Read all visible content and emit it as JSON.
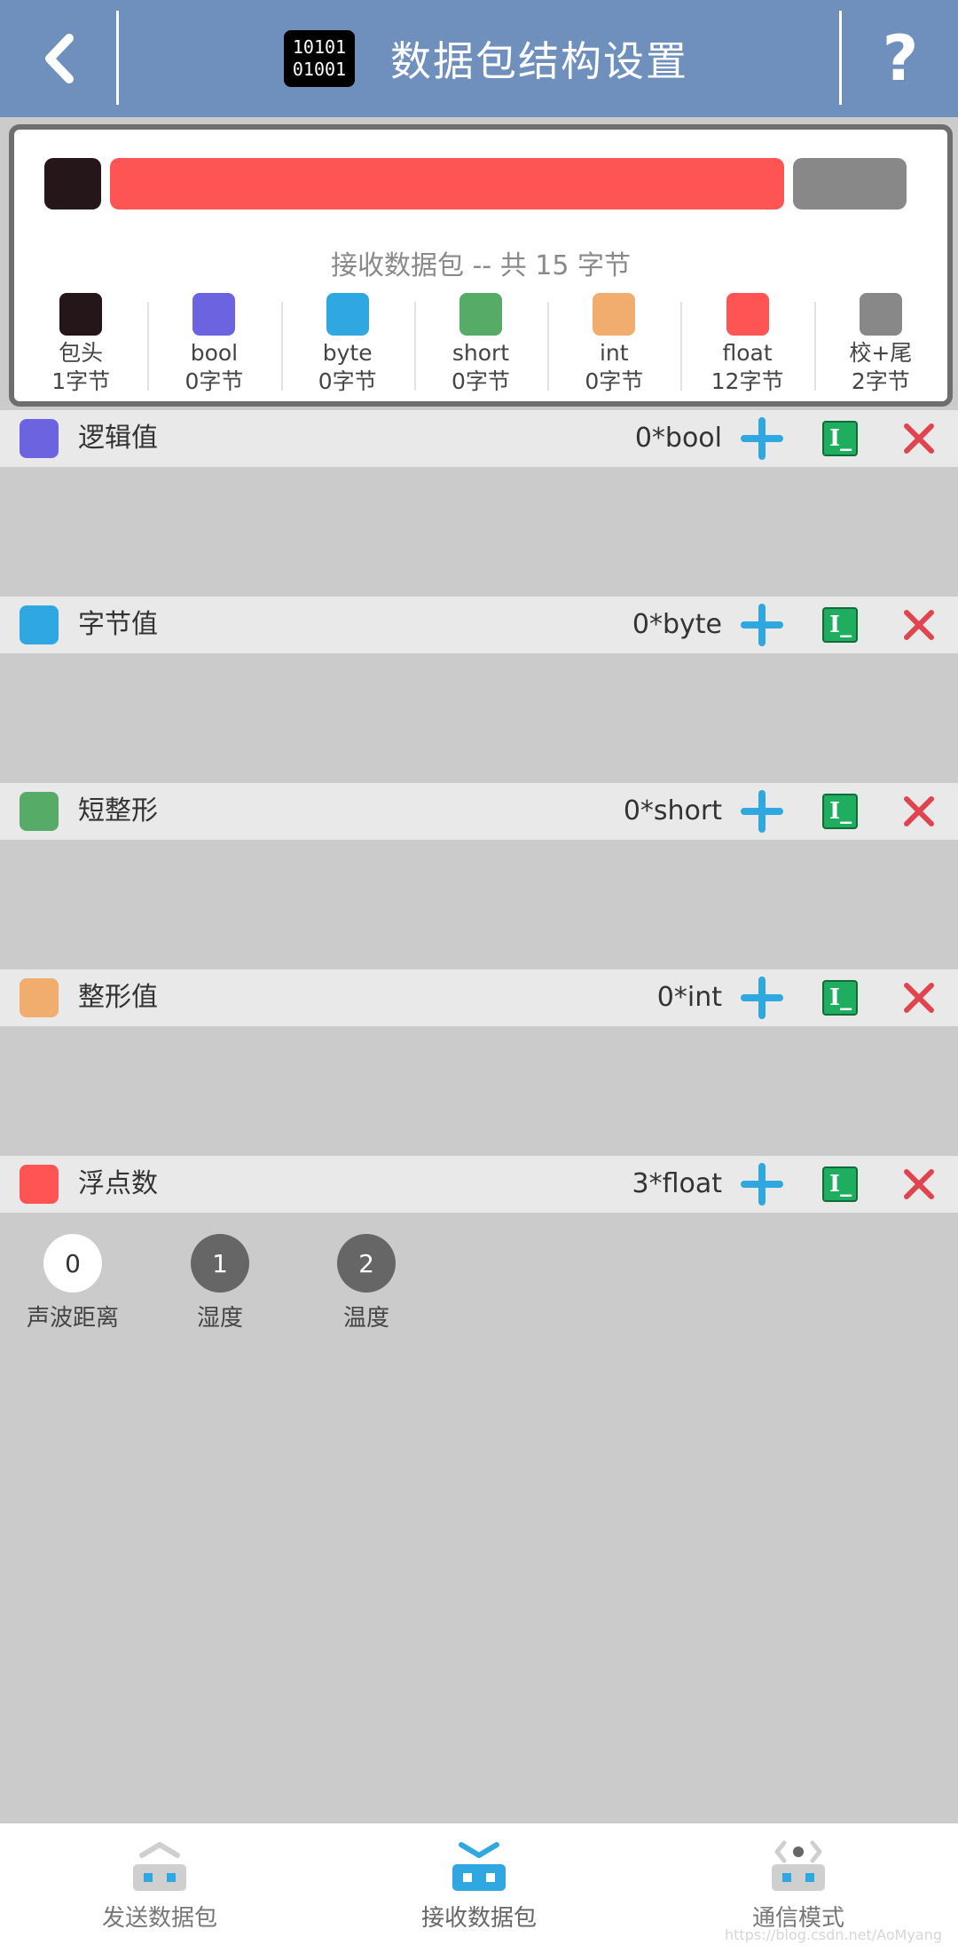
{
  "header": {
    "title": "数据包结构设置",
    "binary_icon_lines": [
      "10101",
      "01001"
    ],
    "help_symbol": "?"
  },
  "summary": {
    "caption": "接收数据包 -- 共 15 字节",
    "legend": [
      {
        "name": "包头",
        "bytes": "1字节",
        "color": "#241619"
      },
      {
        "name": "bool",
        "bytes": "0字节",
        "color": "#6c63e0"
      },
      {
        "name": "byte",
        "bytes": "0字节",
        "color": "#2fa7e0"
      },
      {
        "name": "short",
        "bytes": "0字节",
        "color": "#56ac67"
      },
      {
        "name": "int",
        "bytes": "0字节",
        "color": "#f0ad6d"
      },
      {
        "name": "float",
        "bytes": "12字节",
        "color": "#ff5454"
      },
      {
        "name": "校+尾",
        "bytes": "2字节",
        "color": "#888888"
      }
    ]
  },
  "sections": [
    {
      "title": "逻辑值",
      "count": "0*bool",
      "color": "#6c63e0"
    },
    {
      "title": "字节值",
      "count": "0*byte",
      "color": "#2fa7e0"
    },
    {
      "title": "短整形",
      "count": "0*short",
      "color": "#56ac67"
    },
    {
      "title": "整形值",
      "count": "0*int",
      "color": "#f0ad6d"
    },
    {
      "title": "浮点数",
      "count": "3*float",
      "color": "#ff5454"
    }
  ],
  "float_vars": [
    {
      "index": "0",
      "name": "声波距离",
      "selected": true
    },
    {
      "index": "1",
      "name": "湿度",
      "selected": false
    },
    {
      "index": "2",
      "name": "温度",
      "selected": false
    }
  ],
  "nav": [
    {
      "label": "发送数据包",
      "active": false
    },
    {
      "label": "接收数据包",
      "active": true
    },
    {
      "label": "通信模式",
      "active": false
    }
  ],
  "watermark": "https://blog.csdn.net/AoMyang",
  "colors": {
    "accent": "#2fa7e0",
    "header_bg": "#6f8fbd",
    "delete": "#e0454f",
    "edit": "#1fae5f"
  }
}
